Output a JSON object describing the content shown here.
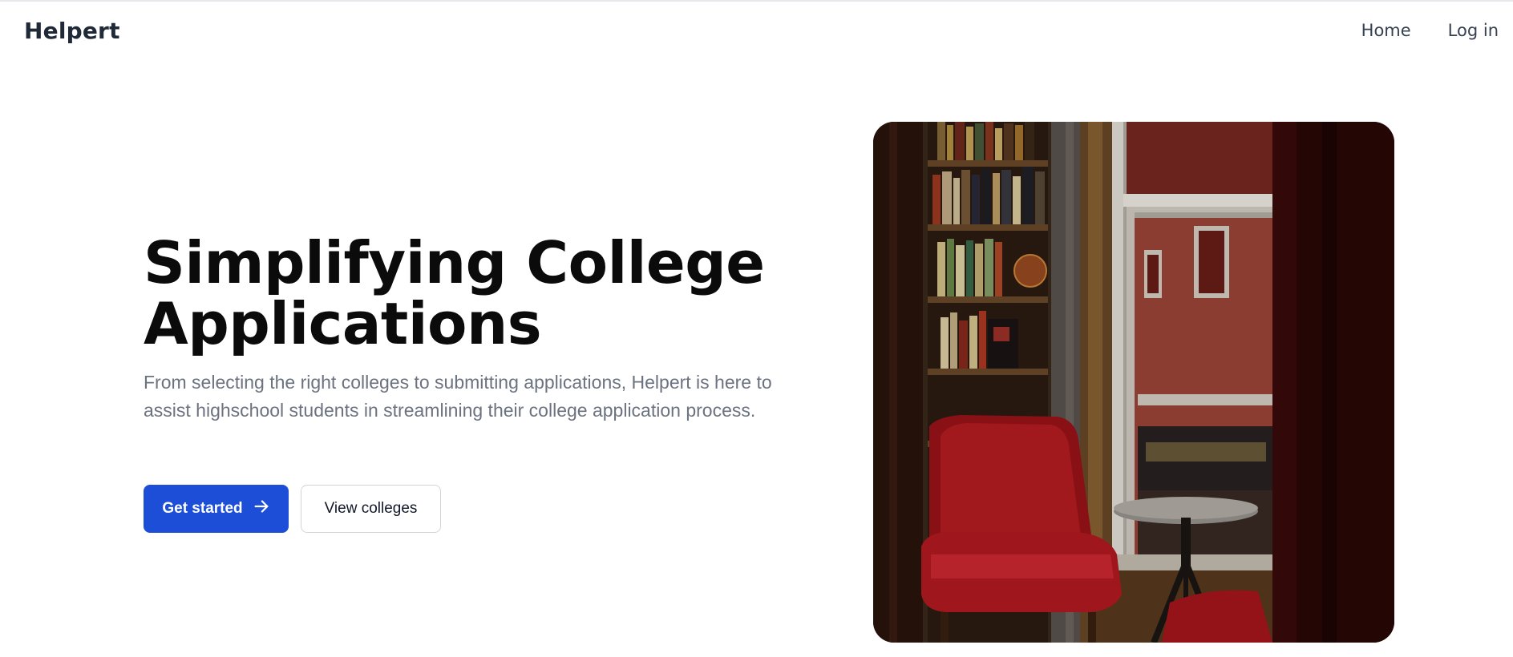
{
  "header": {
    "brand": "Helpert",
    "nav": [
      {
        "label": "Home"
      },
      {
        "label": "Log in"
      }
    ]
  },
  "hero": {
    "title": "Simplifying College Applications",
    "description": "From selecting the right colleges to submitting applications, Helpert is here to assist highschool students in streamlining their college application process.",
    "primary_cta": "Get started",
    "secondary_cta": "View colleges",
    "primary_icon": "arrow-right-icon",
    "image_subject": "bookstore-interior-red-chair-photo"
  },
  "colors": {
    "primary": "#1d4ed8",
    "text": "#0b0b0b",
    "muted": "#6b7280"
  }
}
